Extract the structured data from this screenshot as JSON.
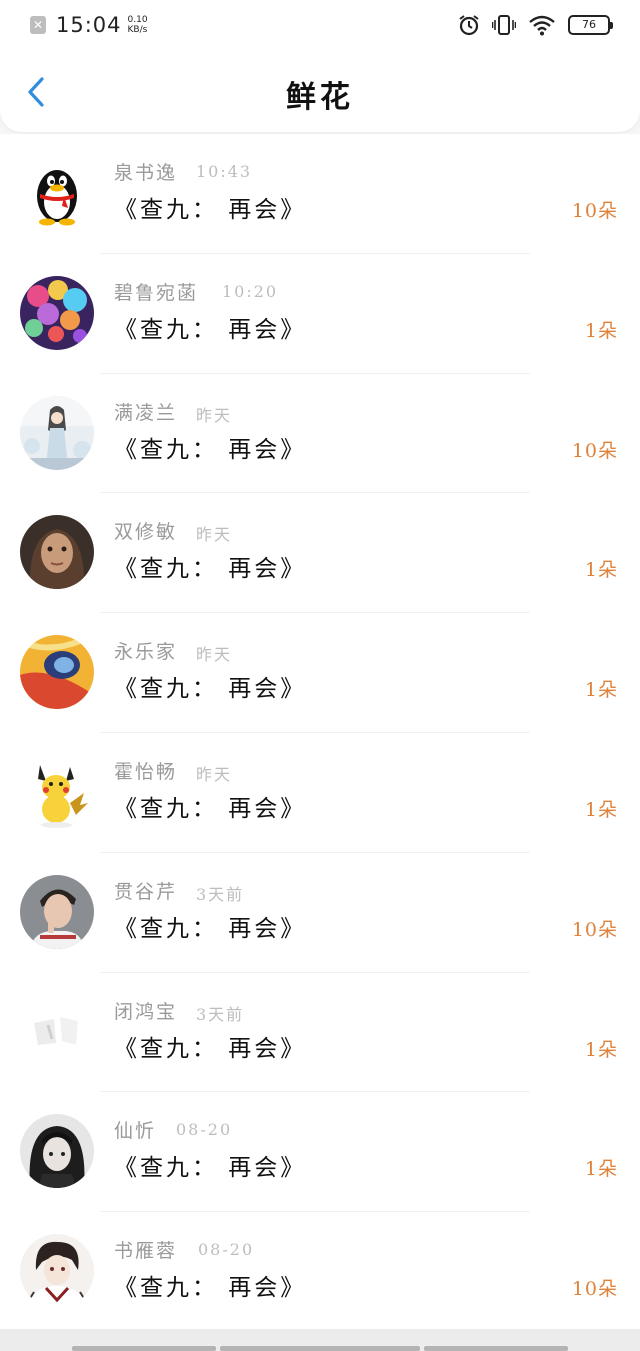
{
  "status_bar": {
    "time": "15:04",
    "net_speed_value": "0.10",
    "net_speed_unit": "KB/s",
    "battery": "76",
    "icons": [
      "notification-icon",
      "alarm-icon",
      "vibrate-icon",
      "wifi-icon",
      "battery-icon"
    ]
  },
  "header": {
    "title": "鲜花",
    "back_icon": "chevron-left-icon"
  },
  "colors": {
    "accent_blue": "#2f8ee0",
    "gift_count": "#e0823a",
    "username": "#9a9a9a",
    "timestamp": "#bdbdbd"
  },
  "items": [
    {
      "username": "泉书逸",
      "time": "10:43",
      "gift": "《查九： 再会》",
      "count": "10朵",
      "avatar": "qq-penguin"
    },
    {
      "username": "碧鲁宛菡",
      "time": "10:20",
      "gift": "《查九： 再会》",
      "count": "1朵",
      "avatar": "balloons-photo"
    },
    {
      "username": "满凌兰",
      "time": "昨天",
      "gift": "《查九： 再会》",
      "count": "10朵",
      "avatar": "anime-girl"
    },
    {
      "username": "双修敏",
      "time": "昨天",
      "gift": "《查九： 再会》",
      "count": "1朵",
      "avatar": "portrait-girl"
    },
    {
      "username": "永乐家",
      "time": "昨天",
      "gift": "《查九： 再会》",
      "count": "1朵",
      "avatar": "colorful-shapes"
    },
    {
      "username": "霍怡畅",
      "time": "昨天",
      "gift": "《查九： 再会》",
      "count": "1朵",
      "avatar": "pikachu"
    },
    {
      "username": "贯谷芹",
      "time": "3天前",
      "gift": "《查九： 再会》",
      "count": "10朵",
      "avatar": "boy-portrait"
    },
    {
      "username": "闭鸿宝",
      "time": "3天前",
      "gift": "《查九： 再会》",
      "count": "1朵",
      "avatar": "faded-sketch"
    },
    {
      "username": "仙忻",
      "time": "08-20",
      "gift": "《查九： 再会》",
      "count": "1朵",
      "avatar": "dark-hair-girl"
    },
    {
      "username": "书雁蓉",
      "time": "08-20",
      "gift": "《查九： 再会》",
      "count": "10朵",
      "avatar": "anime-boy"
    }
  ]
}
